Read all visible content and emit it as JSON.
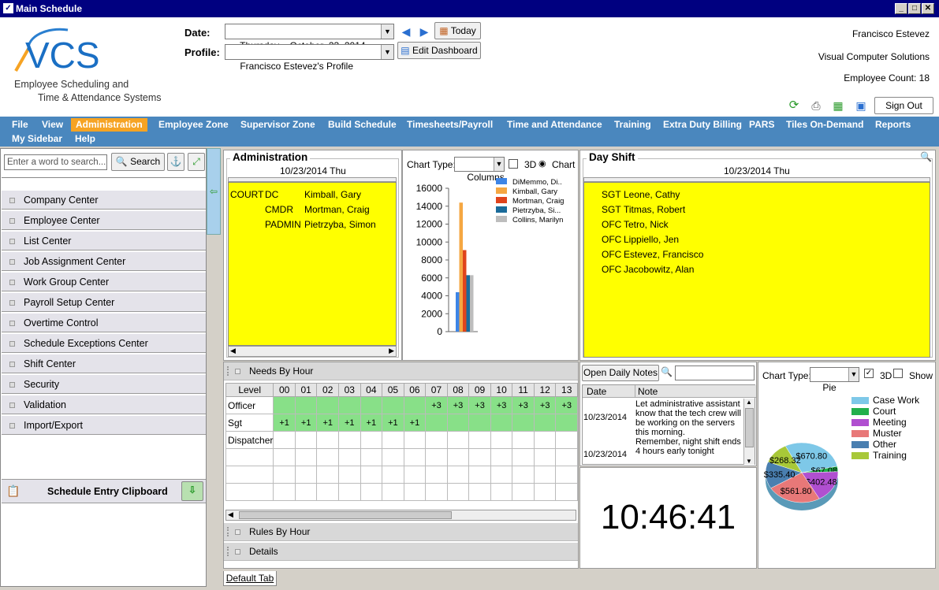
{
  "window": {
    "title": "Main Schedule"
  },
  "logo": {
    "brand": "VCS",
    "tagline1": "Employee Scheduling and",
    "tagline2": "Time & Attendance Systems"
  },
  "header": {
    "date_label": "Date:",
    "date_value": "Thursday ,  October  23, 2014",
    "profile_label": "Profile:",
    "profile_value": "Francisco Estevez's Profile",
    "today_label": "Today",
    "edit_dashboard_label": "Edit Dashboard",
    "user_name": "Francisco Estevez",
    "company": "Visual Computer Solutions",
    "employee_count": "Employee Count: 18",
    "sign_out_label": "Sign Out"
  },
  "menu": {
    "items": [
      "File",
      "View",
      "Administration",
      "Employee Zone",
      "Supervisor Zone",
      "Build Schedule",
      "Timesheets/Payroll",
      "Time and Attendance",
      "Training",
      "Extra Duty Billing",
      "PARS",
      "Tiles On-Demand",
      "Reports",
      "My Sidebar",
      "Help"
    ],
    "active": "Administration"
  },
  "sidebar": {
    "search_placeholder": "Enter a word to search...",
    "search_button": "Search",
    "items": [
      "Company Center",
      "Employee Center",
      "List Center",
      "Job Assignment Center",
      "Work Group Center",
      "Payroll Setup Center",
      "Overtime Control",
      "Schedule Exceptions Center",
      "Shift Center",
      "Security",
      "Validation",
      "Import/Export"
    ],
    "clipboard_label": "Schedule Entry Clipboard"
  },
  "admin_panel": {
    "title": "Administration",
    "date": "10/23/2014 Thu",
    "rows": [
      {
        "group": "COURT",
        "code": "DC",
        "name": "Kimball, Gary"
      },
      {
        "group": "",
        "code": "CMDR",
        "name": "Mortman, Craig"
      },
      {
        "group": "",
        "code": "PADMIN",
        "name": "Pietrzyba, Simon"
      }
    ]
  },
  "column_chart": {
    "chart_type_label": "Chart Type:",
    "chart_type_value": "Columns",
    "three_d_label": "3D",
    "chart_label": "Chart"
  },
  "chart_data": {
    "type": "bar",
    "categories": [
      ""
    ],
    "series": [
      {
        "name": "DiMemmo, Di..",
        "values": [
          4400
        ],
        "color": "#3d85e6"
      },
      {
        "name": "Kimball, Gary",
        "values": [
          14400
        ],
        "color": "#f5a742"
      },
      {
        "name": "Mortman, Craig",
        "values": [
          9100
        ],
        "color": "#e0441c"
      },
      {
        "name": "Pietrzyba, Si...",
        "values": [
          6300
        ],
        "color": "#1a6b9a"
      },
      {
        "name": "Collins, Marilyn",
        "values": [
          6300
        ],
        "color": "#bdbdbd"
      }
    ],
    "ylim": [
      0,
      16000
    ],
    "yticks": [
      "16000",
      "14000",
      "12000",
      "10000",
      "8000",
      "6000",
      "4000",
      "2000",
      "0"
    ],
    "legend": "top-right",
    "grid": false
  },
  "day_shift": {
    "title": "Day Shift",
    "date": "10/23/2014 Thu",
    "rows": [
      {
        "code": "SGT",
        "name": "Leone, Cathy"
      },
      {
        "code": "SGT",
        "name": "Titmas, Robert"
      },
      {
        "code": "OFC",
        "name": "Tetro, Nick"
      },
      {
        "code": "OFC",
        "name": "Lippiello, Jen"
      },
      {
        "code": "OFC",
        "name": "Estevez, Francisco"
      },
      {
        "code": "OFC",
        "name": "Jacobowitz, Alan"
      }
    ]
  },
  "needs_by_hour": {
    "title": "Needs By Hour",
    "level_header": "Level",
    "hours": [
      "00",
      "01",
      "02",
      "03",
      "04",
      "05",
      "06",
      "07",
      "08",
      "09",
      "10",
      "11",
      "12",
      "13"
    ],
    "rows": [
      {
        "level": "Officer",
        "cells": [
          "",
          "",
          "",
          "",
          "",
          "",
          "",
          "+3",
          "+3",
          "+3",
          "+3",
          "+3",
          "+3",
          "+3"
        ]
      },
      {
        "level": "Sgt",
        "cells": [
          "+1",
          "+1",
          "+1",
          "+1",
          "+1",
          "+1",
          "+1",
          "",
          "",
          "",
          "",
          "",
          "",
          ""
        ]
      },
      {
        "level": "Dispatcher",
        "cells": [
          "",
          "",
          "",
          "",
          "",
          "",
          "",
          "",
          "",
          "",
          "",
          "",
          "",
          ""
        ]
      }
    ]
  },
  "rules_by_hour": {
    "title": "Rules By Hour"
  },
  "details": {
    "title": "Details"
  },
  "notes": {
    "open_button": "Open Daily Notes",
    "date_header": "Date",
    "note_header": "Note",
    "entries": [
      {
        "date": "10/23/2014",
        "note": "Let administrative assistant know that the tech crew will be working on the servers this morning."
      },
      {
        "date": "10/23/2014",
        "note": "Remember, night shift ends 4 hours early tonight"
      }
    ]
  },
  "clock": {
    "time": "10:46:41"
  },
  "pie_chart": {
    "chart_type_label": "Chart Type:",
    "chart_type_value": "Pie",
    "three_d_label": "3D",
    "show_label": "Show",
    "legend": [
      {
        "name": "Case Work",
        "color": "#7ec8e8"
      },
      {
        "name": "Court",
        "color": "#22b04c"
      },
      {
        "name": "Meeting",
        "color": "#b04fd0"
      },
      {
        "name": "Muster",
        "color": "#e87878"
      },
      {
        "name": "Other",
        "color": "#4a7fb0"
      },
      {
        "name": "Training",
        "color": "#a8c838"
      }
    ],
    "slices": [
      {
        "name": "Case Work",
        "value": 670.8,
        "label": "$670.80"
      },
      {
        "name": "Court",
        "value": 67.08,
        "label": "$67.08"
      },
      {
        "name": "Meeting",
        "value": 402.48,
        "label": "$402.48"
      },
      {
        "name": "Muster",
        "value": 561.8,
        "label": "$561.80"
      },
      {
        "name": "Other",
        "value": 335.4,
        "label": "$335.40"
      },
      {
        "name": "Training",
        "value": 268.32,
        "label": "$268.32"
      }
    ]
  },
  "tabs": {
    "default": "Default Tab"
  }
}
